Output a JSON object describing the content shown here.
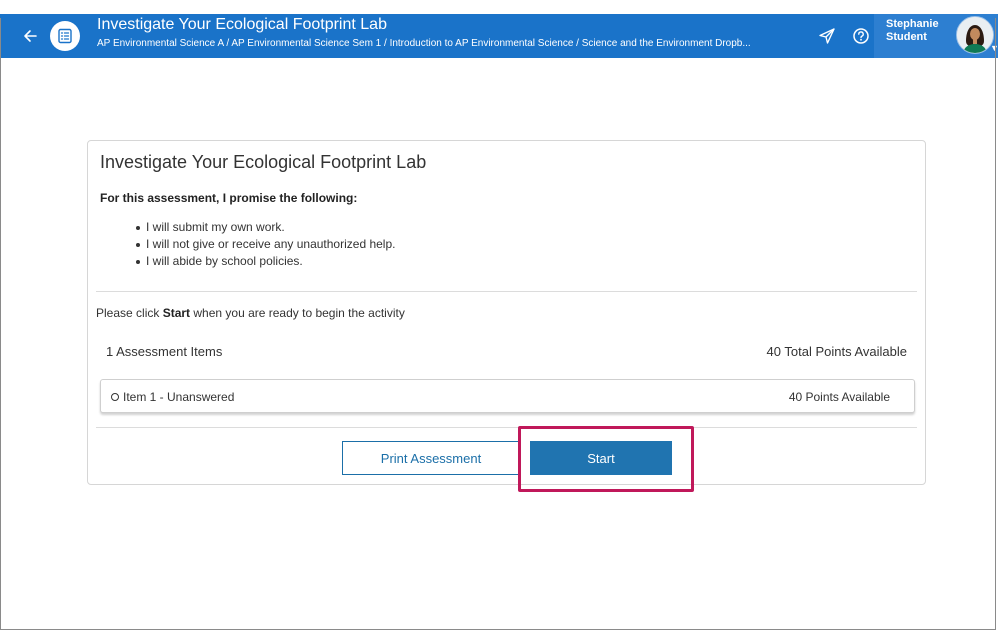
{
  "header": {
    "title": "Investigate Your Ecological Footprint Lab",
    "breadcrumb": "AP Environmental Science A / AP Environmental Science Sem 1 / Introduction to AP Environmental Science / Science and the Environment Dropb...",
    "user_first": "Stephanie",
    "user_last": "Student",
    "icons": {
      "back": "arrow-left-icon",
      "app": "checklist-icon",
      "send": "send-icon",
      "help": "help-icon",
      "avatar": "avatar",
      "caret": "caret-down-icon"
    }
  },
  "card": {
    "title": "Investigate Your Ecological Footprint Lab",
    "promise_heading": "For this assessment, I promise the following:",
    "promises": [
      "I will submit my own work.",
      "I will not give or receive any unauthorized help.",
      "I will abide by school policies."
    ],
    "instruction_prefix": "Please click ",
    "instruction_bold": "Start",
    "instruction_suffix": " when you are ready to begin the activity",
    "items_count": "1 Assessment Items",
    "total_points": "40 Total Points Available",
    "item": {
      "label": "Item 1 - Unanswered",
      "points": "40 Points Available"
    },
    "print_label": "Print Assessment",
    "start_label": "Start"
  },
  "colors": {
    "header_bg": "#1a73c9",
    "user_bg": "#2d7fd1",
    "primary_button": "#2074b0",
    "highlight": "#c0185a"
  }
}
